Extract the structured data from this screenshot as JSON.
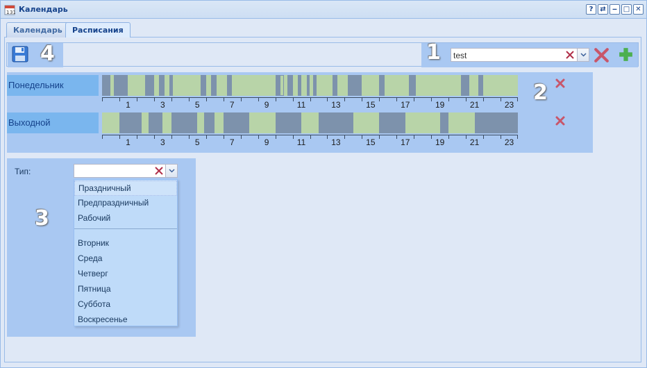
{
  "window": {
    "title": "Календарь",
    "tools": [
      "?",
      "⇄",
      "‒",
      "□",
      "✕"
    ]
  },
  "tabs": [
    {
      "label": "Календарь",
      "active": false
    },
    {
      "label": "Расписания",
      "active": true
    }
  ],
  "annotations": {
    "one": "1",
    "two": "2",
    "three": "3",
    "four": "4"
  },
  "toolbar": {
    "save_icon": "floppy-disk-icon",
    "schedule_combo_value": "test",
    "delete_icon": "red-x-icon",
    "add_icon": "green-plus-icon"
  },
  "schedules": [
    {
      "label": "Понедельник",
      "blocked_hours": [
        [
          0,
          0.5
        ],
        [
          0.7,
          1.5
        ],
        [
          2.5,
          3
        ],
        [
          3.3,
          3.6
        ],
        [
          3.9,
          4.1
        ],
        [
          5.7,
          6
        ],
        [
          6.3,
          6.6
        ],
        [
          7.2,
          7.5
        ],
        [
          10,
          10.3
        ],
        [
          10.7,
          11
        ],
        [
          11.3,
          11.5
        ],
        [
          11.8,
          12
        ],
        [
          12.2,
          12.4
        ],
        [
          13.3,
          13.6
        ],
        [
          14.2,
          15
        ],
        [
          16,
          16.3
        ],
        [
          17.7,
          18.1
        ],
        [
          20.7,
          21.2
        ],
        [
          21.7,
          22
        ]
      ],
      "selected_hour": [
        10,
        10.5
      ]
    },
    {
      "label": "Выходной",
      "blocked_hours": [
        [
          1,
          2.3
        ],
        [
          2.7,
          3.5
        ],
        [
          4,
          5.5
        ],
        [
          5.9,
          6.5
        ],
        [
          7,
          8.5
        ],
        [
          10,
          11.5
        ],
        [
          12.5,
          14.5
        ],
        [
          16,
          17.5
        ],
        [
          19.5,
          20
        ],
        [
          21.5,
          24
        ]
      ],
      "selected_hour": null
    }
  ],
  "axis_labels": [
    "1",
    "3",
    "5",
    "7",
    "9",
    "11",
    "13",
    "15",
    "17",
    "19",
    "21",
    "23"
  ],
  "type_field": {
    "label": "Тип:",
    "value": "",
    "options_group1": [
      "Праздничный",
      "Предпраздничный",
      "Рабочий"
    ],
    "options_group2": [
      "Вторник",
      "Среда",
      "Четверг",
      "Пятница",
      "Суббота",
      "Воскресенье"
    ],
    "highlighted": "Праздничный"
  },
  "colors": {
    "free": "#b8d4a8",
    "blocked": "#7d92ac",
    "highlight": "#a9c8f2",
    "label_bg": "#7ab6ee"
  }
}
